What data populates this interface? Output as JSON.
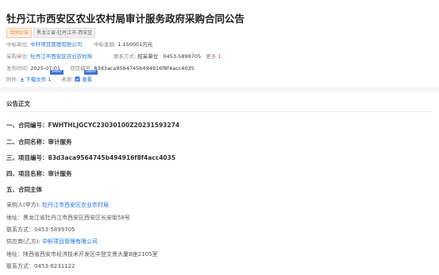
{
  "header": {
    "title": "牡丹江市西安区农业农村局审计服务政府采购合同公告",
    "tags": {
      "type": "合同公告",
      "region": "黑龙江省-牡丹江市-西安区"
    },
    "winner_label": "中标单位:",
    "winner_value": "中轩项目管理有限公司",
    "amount_label": "中标金额:",
    "amount_value": "1.150001万元",
    "buyer_label": "采购单位:",
    "buyer_value": "牡丹江市西安区农业农村局",
    "contact_label": "联系方式:",
    "contact_hint": "招采单位",
    "contact_value": "0453-5899705",
    "more_label": "更多",
    "more_count": "1",
    "publish_label": "发布时间:",
    "publish_value": "2025-07-01",
    "project_no_label": "项目编号:",
    "project_no_value": "83d3aca9564745b494916f8f4acc4035",
    "attach_label": "附件:",
    "attach_value": "下载文件 1",
    "source_label": "来源:",
    "source_value": "查看",
    "badge_swap": "SWAP"
  },
  "body": {
    "section_title": "公告正文",
    "items": [
      "一、合同编号：FWHTHLJGCYC23030100Z20231593274",
      "二、合同名称：审计服务",
      "三、项目编号：83d3aca9564745b494916f8f4acc4035",
      "四、项目名称：审计服务",
      "五、合同主体"
    ],
    "buyer_party_label": "采购人(甲方):",
    "buyer_party_name": "牡丹江市西安区农业农村局",
    "buyer_address": "地址：黑龙江省牡丹江市西安区西安区长安街58号",
    "buyer_phone": "联系方式：0453-5899705",
    "supplier_label": "供应商(乙方):",
    "supplier_name": "中轩项目管理有限公司",
    "supplier_address": "地址：陕西省西安市经济技术开发区中登文景大厦B座2105室",
    "supplier_phone": "联系方式：0453-8231122"
  },
  "colors": {
    "link": "#1a6fd6",
    "tag_orange": "#f07c1c",
    "badge_blue": "#3a73d9"
  }
}
